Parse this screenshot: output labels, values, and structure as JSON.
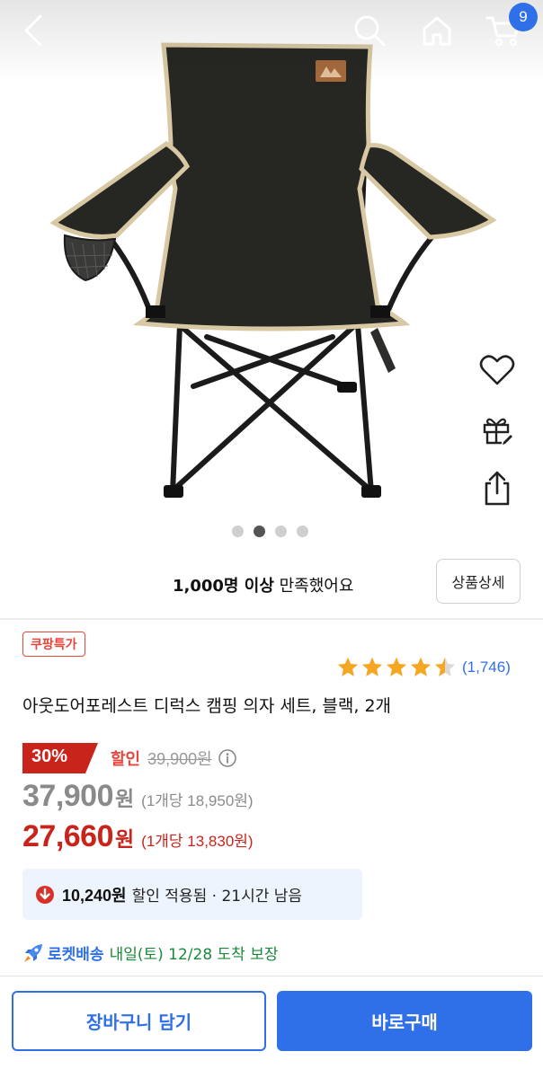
{
  "header": {
    "back_icon": "chevron-left-icon",
    "search_icon": "search-icon",
    "home_icon": "home-icon",
    "cart_icon": "cart-icon",
    "cart_count": "9"
  },
  "hero": {
    "image": "black folding camping chair with beige trim",
    "slides_total": 4,
    "slide_active": 2
  },
  "side_actions": [
    "heart-icon",
    "gift-icon",
    "share-icon"
  ],
  "satisfaction": {
    "count": "1,000명 이상",
    "text": "만족했어요",
    "detail_button": "상품상세"
  },
  "product": {
    "tag": "쿠팡특가",
    "rating": 4.5,
    "review_count": "(1,746)",
    "title": "아웃도어포레스트 디럭스 캠핑 의자 세트, 블랙, 2개",
    "discount_percent": "30%",
    "discount_label": "할인",
    "original_price": "39,900원",
    "sale_price": "37,900",
    "sale_price_unit": "원",
    "sale_per_unit": "(1개당 18,950원)",
    "coupon_price": "27,660",
    "coupon_price_unit": "원",
    "coupon_per_unit": "(1개당 13,830원)",
    "coupon_amount": "10,240원",
    "coupon_text": "할인 적용됨 · 21시간 남음",
    "delivery_label": "로켓배송",
    "delivery_text": "내일(토) 12/28 도착 보장"
  },
  "bottom": {
    "cart_button": "장바구니 담기",
    "buy_button": "바로구매"
  },
  "colors": {
    "accent": "#2f6fe8",
    "discount_red": "#e8463b",
    "price_red": "#c8241b",
    "delivery_green": "#1a8a3a",
    "star": "#f5a623"
  }
}
